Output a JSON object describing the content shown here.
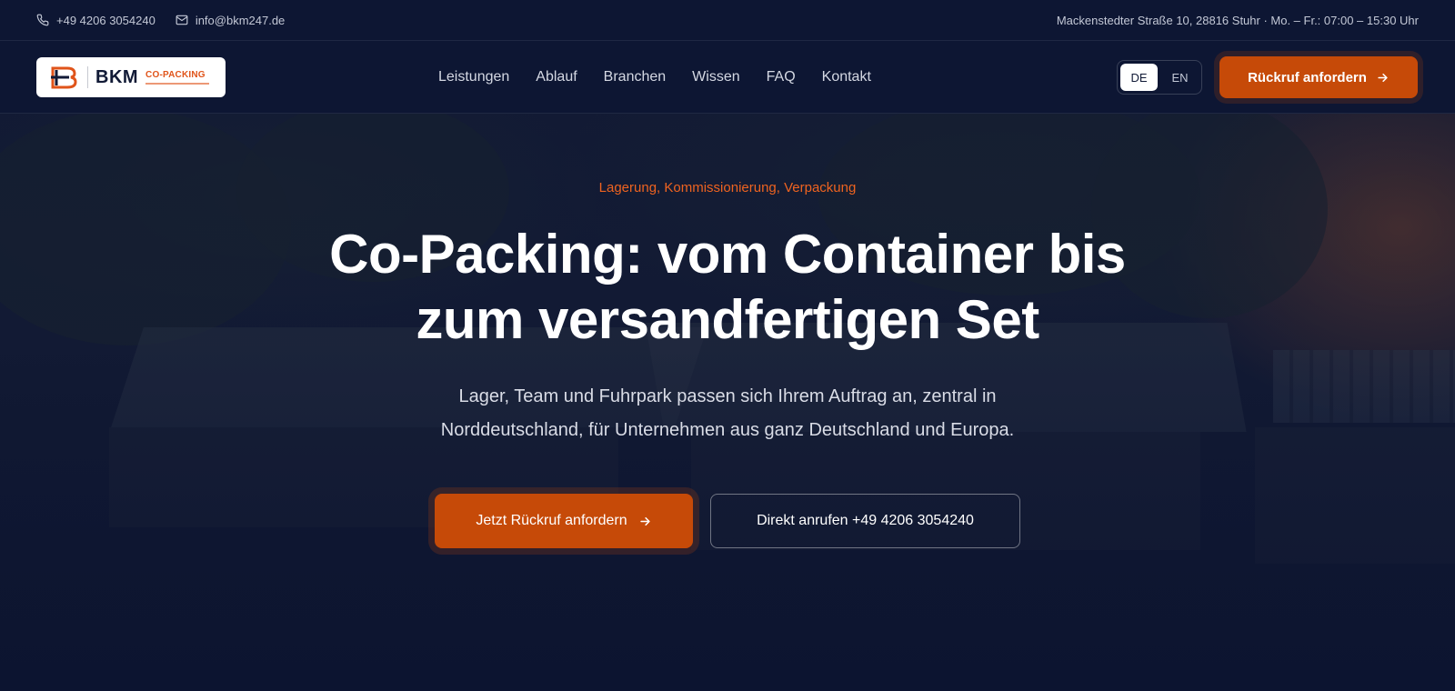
{
  "topbar": {
    "phone": "+49 4206 3054240",
    "email": "info@bkm247.de",
    "address_hours": "Mackenstedter Straße 10, 28816 Stuhr · Mo. – Fr.: 07:00 – 15:30 Uhr"
  },
  "logo": {
    "brand": "BKM",
    "tagline": "CO-PACKING"
  },
  "nav": {
    "items": [
      "Leistungen",
      "Ablauf",
      "Branchen",
      "Wissen",
      "FAQ",
      "Kontakt"
    ],
    "languages": [
      "DE",
      "EN"
    ],
    "active_language": "DE",
    "cta": "Rückruf anfordern"
  },
  "hero": {
    "eyebrow": "Lagerung, Kommissionierung, Verpackung",
    "headline_line1": "Co-Packing: vom Container bis",
    "headline_line2": "zum versandfertigen Set",
    "subline_line1": "Lager, Team und Fuhrpark passen sich Ihrem Auftrag an, zentral in",
    "subline_line2": "Norddeutschland, für Unternehmen aus ganz Deutschland und Europa.",
    "primary_button": "Jetzt Rückruf anfordern",
    "secondary_button": "Direkt anrufen +49 4206 3054240"
  },
  "colors": {
    "accent": "#C64A08",
    "background": "#0D1633",
    "eyebrow": "#EE6320"
  }
}
